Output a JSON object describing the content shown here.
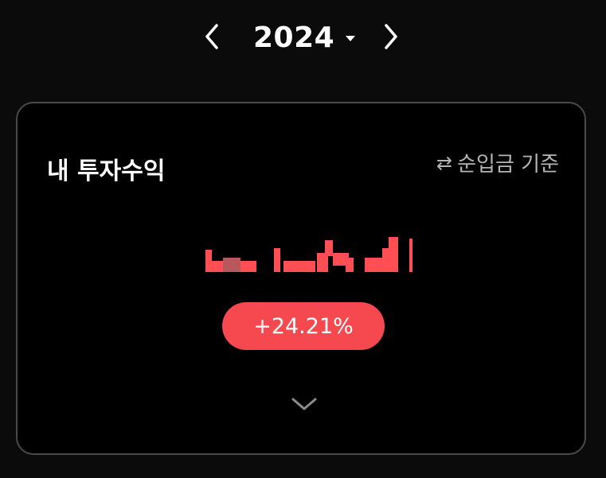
{
  "header": {
    "year": "2024",
    "prev_icon": "chevron-left-icon",
    "next_icon": "chevron-right-icon",
    "dropdown_icon": "caret-down-icon"
  },
  "card": {
    "title": "내 투자수익",
    "basis_toggle": {
      "icon": "swap-arrows-icon",
      "label": "순입금 기준"
    },
    "profit_rate": "+24.21%",
    "expand_icon": "chevron-down-icon"
  },
  "colors": {
    "background": "#0b0b0b",
    "card_background": "#000000",
    "card_border": "#4a4a4a",
    "accent_red": "#f5494f",
    "muted_text": "#b5b5b5"
  }
}
